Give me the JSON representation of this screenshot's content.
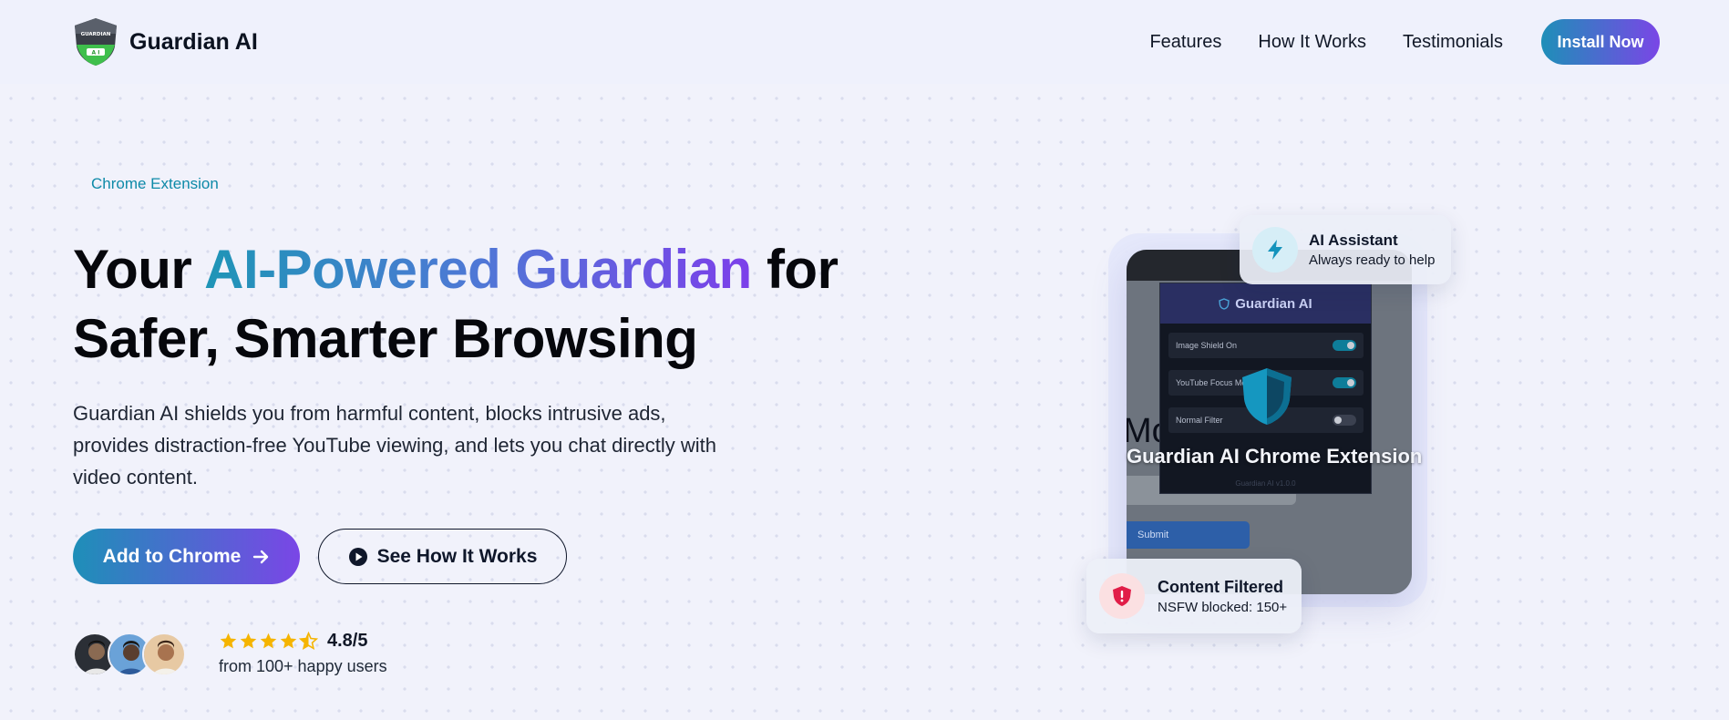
{
  "brand": {
    "name": "Guardian AI",
    "logo_text": "GUARDIAN",
    "logo_badge": "A I"
  },
  "nav": {
    "links": [
      "Features",
      "How It Works",
      "Testimonials"
    ],
    "install_label": "Install Now"
  },
  "hero": {
    "badge": "Chrome Extension",
    "title_part1": "Your ",
    "title_highlight": "AI-Powered Guardian",
    "title_part2": " for",
    "title_line2": "Safer, Smarter Browsing",
    "description": "Guardian AI shields you from harmful content, blocks intrusive ads, provides distraction-free YouTube viewing, and lets you chat directly with video content.",
    "primary_cta": "Add to Chrome",
    "secondary_cta": "See How It Works"
  },
  "social_proof": {
    "rating": "4.8/5",
    "stars": 4.5,
    "subtitle": "from 100+ happy users"
  },
  "mockup": {
    "popup_title": "Guardian AI",
    "rows": [
      {
        "label": "Image Shield On",
        "on": true
      },
      {
        "label": "YouTube Focus Mode",
        "on": true
      },
      {
        "label": "Normal Filter",
        "on": false
      }
    ],
    "version": "Guardian AI v1.0.0",
    "bg_text": "Mo",
    "submit_label": "Submit",
    "overlay_title": "Guardian AI Chrome Extension"
  },
  "cards": {
    "ai_title": "AI Assistant",
    "ai_sub": "Always ready to help",
    "filter_title": "Content Filtered",
    "filter_sub": "NSFW blocked: 150+"
  },
  "colors": {
    "accent_start": "#1e8fb8",
    "accent_end": "#7a46e6",
    "star": "#f5b400",
    "danger": "#e11d48"
  }
}
